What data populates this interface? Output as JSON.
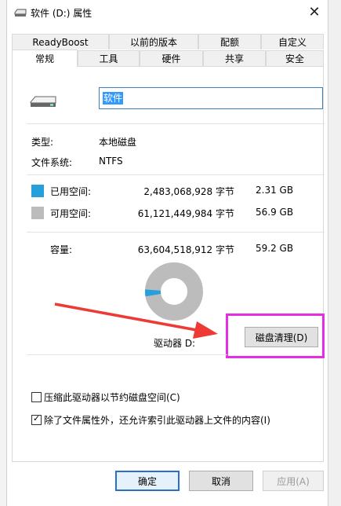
{
  "window": {
    "title": "软件 (D:) 属性",
    "close_glyph": "✕"
  },
  "tabs_top": [
    "ReadyBoost",
    "以前的版本",
    "配额",
    "自定义"
  ],
  "tabs_bottom": [
    "常规",
    "工具",
    "硬件",
    "共享",
    "安全"
  ],
  "active_tab": "常规",
  "general": {
    "volume_name": "软件",
    "type_label": "类型:",
    "type_value": "本地磁盘",
    "fs_label": "文件系统:",
    "fs_value": "NTFS",
    "used_label": "已用空间:",
    "used_bytes": "2,483,068,928 字节",
    "used_size": "2.31 GB",
    "free_label": "可用空间:",
    "free_bytes": "61,121,449,984 字节",
    "free_size": "56.9 GB",
    "capacity_label": "容量:",
    "capacity_bytes": "63,604,518,912 字节",
    "capacity_size": "59.2 GB",
    "used_fraction": 0.039,
    "drive_label": "驱动器 D:",
    "cleanup_button": "磁盘清理(D)",
    "compress_label": "压缩此驱动器以节约磁盘空间(C)",
    "compress_checked": false,
    "index_label": "除了文件属性外，还允许索引此驱动器上文件的内容(I)",
    "index_checked": true
  },
  "buttons": {
    "ok": "确定",
    "cancel": "取消",
    "apply": "应用(A)"
  },
  "colors": {
    "used": "#26a0da",
    "free": "#bcbcbc",
    "highlight": "#e52ee2",
    "arrow": "#ee3a35"
  }
}
